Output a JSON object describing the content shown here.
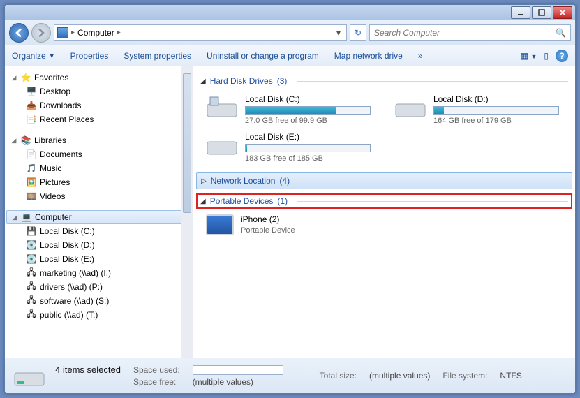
{
  "titlebar": {},
  "address": {
    "location": "Computer",
    "search_placeholder": "Search Computer"
  },
  "toolbar": {
    "organize": "Organize",
    "properties": "Properties",
    "system_properties": "System properties",
    "uninstall": "Uninstall or change a program",
    "map_network": "Map network drive",
    "overflow": "»"
  },
  "tree": {
    "favorites": {
      "label": "Favorites",
      "items": [
        "Desktop",
        "Downloads",
        "Recent Places"
      ]
    },
    "libraries": {
      "label": "Libraries",
      "items": [
        "Documents",
        "Music",
        "Pictures",
        "Videos"
      ]
    },
    "computer": {
      "label": "Computer",
      "items": [
        "Local Disk (C:)",
        "Local Disk (D:)",
        "Local Disk (E:)",
        "marketing (\\\\ad) (I:)",
        "drivers (\\\\ad) (P:)",
        "software (\\\\ad) (S:)",
        "public (\\\\ad) (T:)"
      ]
    }
  },
  "groups": {
    "hdd": {
      "title": "Hard Disk Drives",
      "count": "(3)"
    },
    "net": {
      "title": "Network Location",
      "count": "(4)"
    },
    "port": {
      "title": "Portable Devices",
      "count": "(1)"
    }
  },
  "drives": [
    {
      "name": "Local Disk (C:)",
      "free": "27.0 GB free of 99.9 GB",
      "pct": 73
    },
    {
      "name": "Local Disk (D:)",
      "free": "164 GB free of 179 GB",
      "pct": 8
    },
    {
      "name": "Local Disk (E:)",
      "free": "183 GB free of 185 GB",
      "pct": 1
    }
  ],
  "device": {
    "name": "iPhone (2)",
    "type": "Portable Device"
  },
  "status": {
    "selected": "4 items selected",
    "space_used_lbl": "Space used:",
    "total_size_lbl": "Total size:",
    "total_size_val": "(multiple values)",
    "space_free_lbl": "Space free:",
    "space_free_val": "(multiple values)",
    "fs_lbl": "File system:",
    "fs_val": "NTFS"
  }
}
